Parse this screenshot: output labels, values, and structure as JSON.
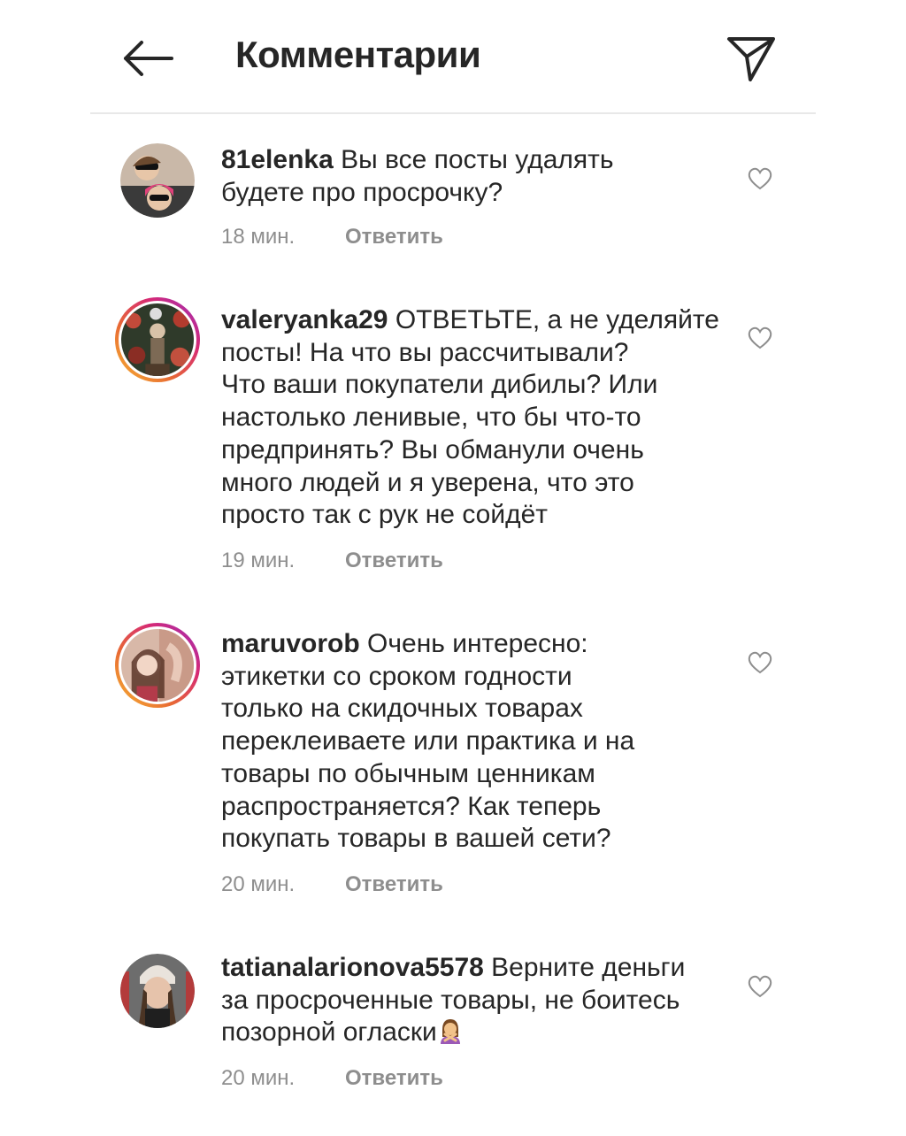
{
  "header": {
    "title": "Комментарии",
    "back_icon": "arrow-left-icon",
    "send_icon": "paper-plane-icon"
  },
  "comments": [
    {
      "username": "81elenka",
      "text": "Вы все посты удалять\nбудете про просрочку?",
      "time": "18 мин.",
      "reply": "Ответить"
    },
    {
      "username": "valeryanka29",
      "text": "ОТВЕТЬТЕ, а не уделяйте\nпосты! На что вы рассчитывали?\nЧто ваши покупатели дибилы? Или\nнастолько ленивые, что бы что-то\nпредпринять? Вы обманули очень\nмного людей и я уверена, что это\nпросто так с рук не сойдёт",
      "time": "19 мин.",
      "reply": "Ответить"
    },
    {
      "username": "maruvorob",
      "text": "Очень интересно:\nэтикетки со сроком годности\nтолько на скидочных товарах\nпереклеиваете или практика и на\nтовары по обычным ценникам\nраспространяется? Как теперь\nпокупать товары в вашей сети?",
      "time": "20 мин.",
      "reply": "Ответить"
    },
    {
      "username": "tatianalarionova5578",
      "text": "Верните деньги\nза просроченные товары, не боитесь\nпозорной огласки",
      "time": "20 мин.",
      "reply": "Ответить",
      "emoji": "person-gesturing-no-emoji"
    }
  ],
  "colors": {
    "text": "#262626",
    "secondary": "#8e8e8e",
    "story_ring": [
      "#f7b733",
      "#d62976",
      "#962fbf"
    ]
  }
}
